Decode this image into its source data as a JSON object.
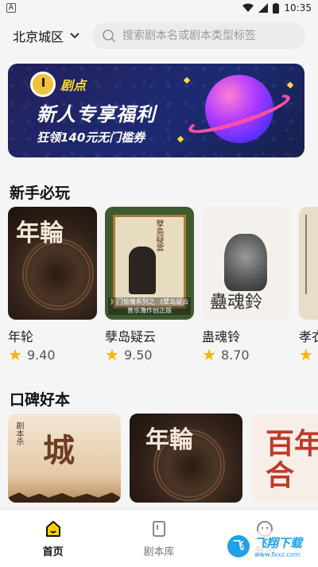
{
  "status_bar": {
    "app_icon": "A",
    "time": "10:35",
    "icons": [
      "wifi-icon",
      "signal-icon",
      "battery-icon"
    ]
  },
  "header": {
    "city": "北京城区",
    "search_placeholder": "搜索剧本名或剧本类型标签"
  },
  "banner": {
    "brand": "剧点",
    "title": "新人专享福利",
    "subtitle": "狂领140元无门槛券"
  },
  "sections": [
    {
      "title": "新手必玩",
      "items": [
        {
          "name": "年轮",
          "score": "9.40",
          "cover_text": "年輪"
        },
        {
          "name": "孽岛疑云",
          "score": "9.50",
          "cover_text": "孽島疑雲",
          "cover_caption": "》门惊情系列之 《孽岛疑云 普乐簿作创正版"
        },
        {
          "name": "蛊魂铃",
          "score": "8.70",
          "cover_text": "蠱魂鈴"
        },
        {
          "name": "孝衣",
          "score": ""
        }
      ]
    },
    {
      "title": "口碑好本",
      "items": [
        {
          "cover_text": "城",
          "cover_vertical": "剧本杀"
        },
        {
          "cover_text": "年輪"
        },
        {
          "cover_text": "百年好合"
        }
      ]
    }
  ],
  "tabs": [
    {
      "label": "首页",
      "icon": "home-icon",
      "active": true
    },
    {
      "label": "剧本库",
      "icon": "library-icon",
      "active": false
    },
    {
      "label": "我的",
      "icon": "profile-icon",
      "active": false
    }
  ],
  "watermark": {
    "logo": "飞",
    "main": "飞翔下载",
    "url": "www.fxxz.com"
  },
  "colors": {
    "accent": "#f8b500",
    "banner_bg": "#1d2a73",
    "search_bg": "#ececec"
  }
}
